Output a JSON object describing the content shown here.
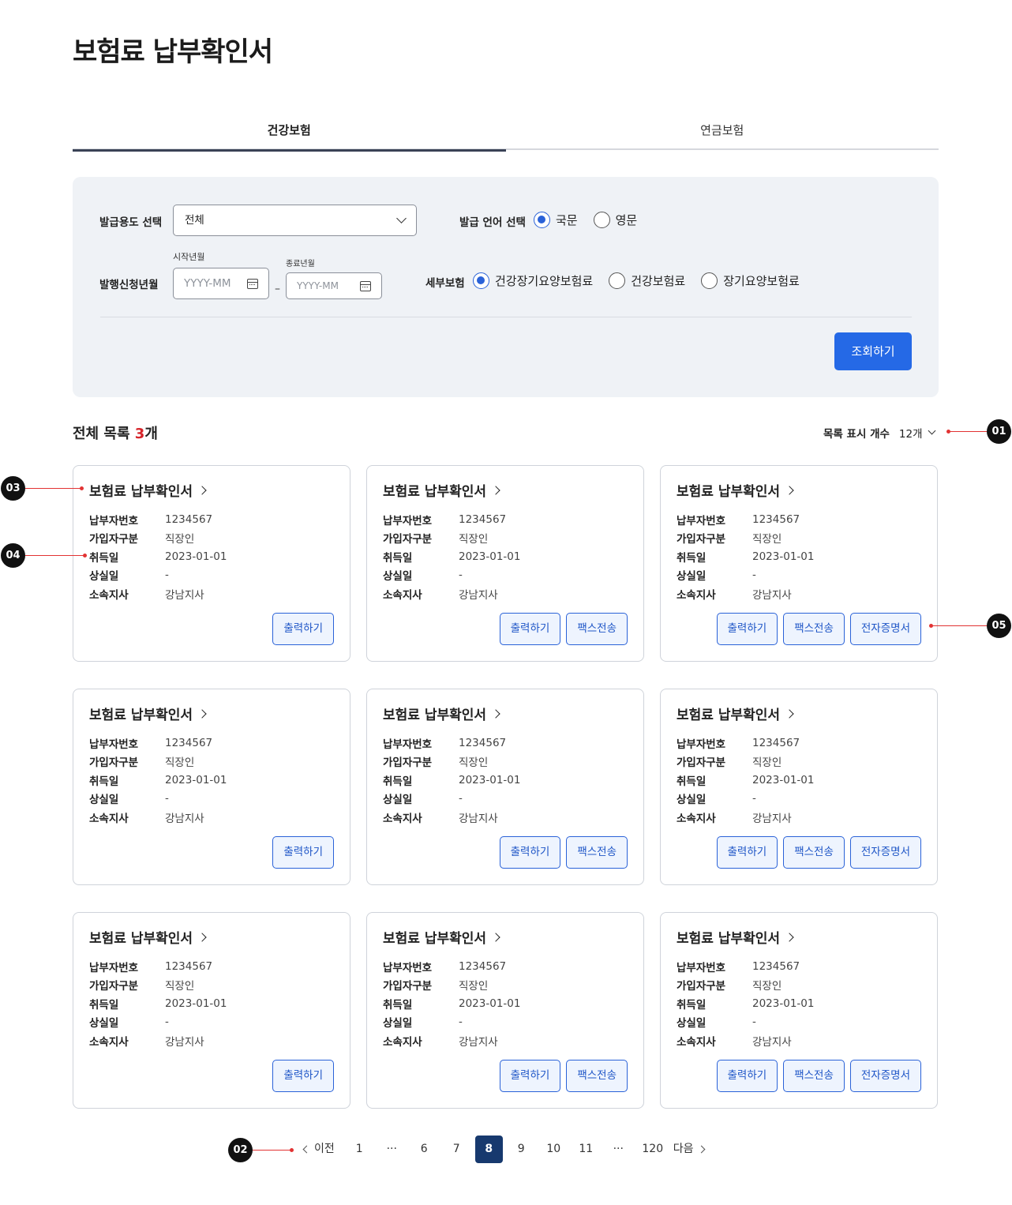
{
  "page": {
    "title": "보험료 납부확인서"
  },
  "tabs": [
    {
      "label": "건강보험"
    },
    {
      "label": "연금보험"
    }
  ],
  "filter": {
    "purpose_label": "발급용도 선택",
    "purpose_value": "전체",
    "language_label": "발급 언어 선택",
    "language_options": [
      {
        "label": "국문"
      },
      {
        "label": "영문"
      }
    ],
    "period_label": "발행신청년월",
    "start_caption": "시작년월",
    "end_caption": "종료년월",
    "start_placeholder": "YYYY-MM",
    "end_placeholder": "YYYY-MM",
    "range_separator": "–",
    "insurance_label": "세부보험",
    "insurance_options": [
      {
        "label": "건강장기요양보험료"
      },
      {
        "label": "건강보험료"
      },
      {
        "label": "장기요양보험료"
      }
    ],
    "search_button": "조회하기"
  },
  "list": {
    "title_prefix": "전체 목록 ",
    "count": "3",
    "title_suffix": "개",
    "per_page_label": "목록 표시 개수",
    "per_page_value": "12개"
  },
  "card_labels": {
    "title": "보험료 납부확인서",
    "payer_no": "납부자번호",
    "member_type": "가입자구분",
    "acquired": "취득일",
    "lost": "상실일",
    "branch": "소속지사",
    "print": "출력하기",
    "fax": "팩스전송",
    "e_cert": "전자증명서"
  },
  "cards": [
    {
      "payer_no": "1234567",
      "member_type": "직장인",
      "acquired": "2023-01-01",
      "lost": "-",
      "branch": "강남지사"
    },
    {
      "payer_no": "1234567",
      "member_type": "직장인",
      "acquired": "2023-01-01",
      "lost": "-",
      "branch": "강남지사"
    },
    {
      "payer_no": "1234567",
      "member_type": "직장인",
      "acquired": "2023-01-01",
      "lost": "-",
      "branch": "강남지사"
    },
    {
      "payer_no": "1234567",
      "member_type": "직장인",
      "acquired": "2023-01-01",
      "lost": "-",
      "branch": "강남지사"
    },
    {
      "payer_no": "1234567",
      "member_type": "직장인",
      "acquired": "2023-01-01",
      "lost": "-",
      "branch": "강남지사"
    },
    {
      "payer_no": "1234567",
      "member_type": "직장인",
      "acquired": "2023-01-01",
      "lost": "-",
      "branch": "강남지사"
    },
    {
      "payer_no": "1234567",
      "member_type": "직장인",
      "acquired": "2023-01-01",
      "lost": "-",
      "branch": "강남지사"
    },
    {
      "payer_no": "1234567",
      "member_type": "직장인",
      "acquired": "2023-01-01",
      "lost": "-",
      "branch": "강남지사"
    },
    {
      "payer_no": "1234567",
      "member_type": "직장인",
      "acquired": "2023-01-01",
      "lost": "-",
      "branch": "강남지사"
    }
  ],
  "pagination": {
    "prev": "이전",
    "next": "다음",
    "ellipsis": "···",
    "pages": [
      "1",
      "6",
      "7",
      "8",
      "9",
      "10",
      "11",
      "120"
    ],
    "current": "8"
  },
  "markers": {
    "m01": "01",
    "m02": "02",
    "m03": "03",
    "m04": "04",
    "m05": "05"
  },
  "colors": {
    "primary": "#2569e6",
    "active_page": "#17396e",
    "count_red": "#d6242a",
    "panel_bg": "#eff2f6"
  }
}
